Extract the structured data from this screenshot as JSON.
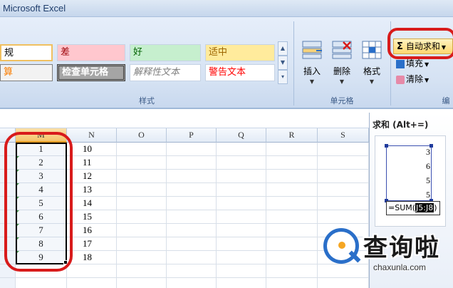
{
  "window": {
    "title": "Microsoft Excel"
  },
  "ribbon": {
    "styles": {
      "group_label": "样式",
      "items": [
        {
          "label": "规",
          "class": "sb-normal"
        },
        {
          "label": "差",
          "class": "sb-bad"
        },
        {
          "label": "好",
          "class": "sb-good"
        },
        {
          "label": "适中",
          "class": "sb-neutral"
        },
        {
          "label": "算",
          "class": "sb-calc"
        },
        {
          "label": "检查单元格",
          "class": "sb-check"
        },
        {
          "label": "解释性文本",
          "class": "sb-explain"
        },
        {
          "label": "警告文本",
          "class": "sb-warn"
        }
      ]
    },
    "cells": {
      "group_label": "单元格",
      "insert": "插入",
      "delete": "删除",
      "format": "格式"
    },
    "editing": {
      "group_label": "编",
      "autosum": "自动求和",
      "fill": "填充",
      "clear": "清除"
    }
  },
  "sheet": {
    "columns": [
      "M",
      "N",
      "O",
      "P",
      "Q",
      "R",
      "S"
    ],
    "active_column": "M",
    "col_m": [
      "1",
      "2",
      "3",
      "4",
      "5",
      "6",
      "7",
      "8",
      "9"
    ],
    "col_n": [
      "10",
      "11",
      "12",
      "13",
      "14",
      "15",
      "16",
      "17",
      "18"
    ]
  },
  "tooltip": {
    "title": "求和 (Alt+=)",
    "values": [
      "3",
      "6",
      "5",
      "5"
    ],
    "formula_prefix": "=SUM(",
    "formula_range": "J5:J8",
    "formula_suffix": ")"
  },
  "watermark": {
    "brand": "查询啦",
    "domain": "chaxunla.com"
  },
  "colors": {
    "accent": "#d81b1b",
    "ribbon": "#d5e2f3",
    "brand_blue": "#2a6fc9"
  }
}
